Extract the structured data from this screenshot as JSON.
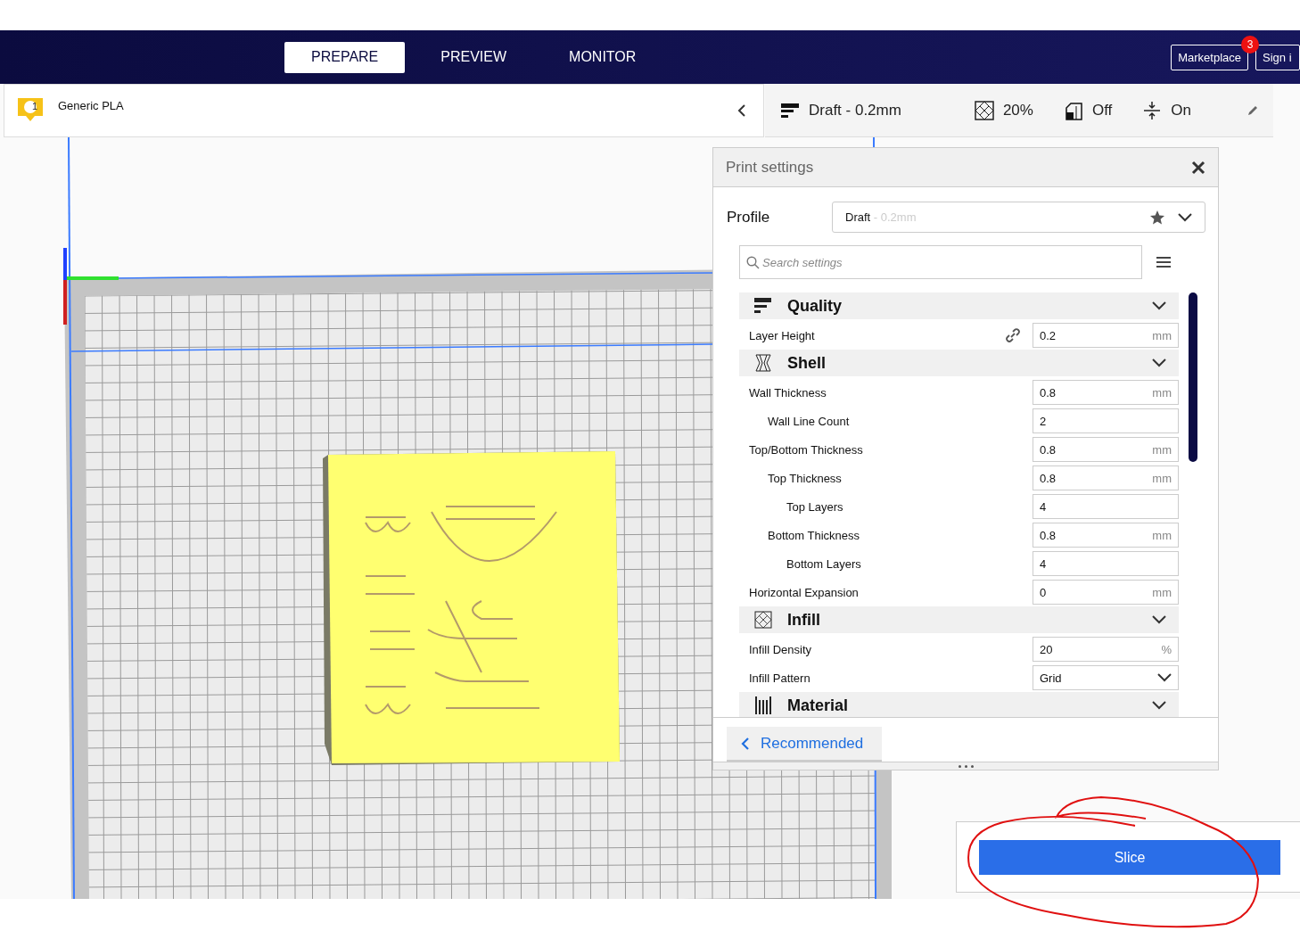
{
  "header": {
    "tabs": [
      {
        "label": "PREPARE",
        "selected": true
      },
      {
        "label": "PREVIEW",
        "selected": false
      },
      {
        "label": "MONITOR",
        "selected": false
      }
    ],
    "marketplace": {
      "label": "Marketplace",
      "badge": "3"
    },
    "sign_in": "Sign i"
  },
  "material_bar": {
    "extruder": "1",
    "material": "Generic PLA"
  },
  "settings_summary": {
    "profile": "Draft - 0.2mm",
    "infill": "20%",
    "support": "Off",
    "adhesion": "On"
  },
  "print_settings": {
    "title": "Print settings",
    "profile_label": "Profile",
    "profile": {
      "name": "Draft",
      "detail": " - 0.2mm"
    },
    "search": {
      "placeholder": "Search settings"
    },
    "categories": [
      {
        "title": "Quality",
        "kind": "quality",
        "expanded": true,
        "settings": [
          {
            "label": "Layer Height",
            "value": "0.2",
            "unit": "mm",
            "kind": "number",
            "linked": true
          }
        ]
      },
      {
        "title": "Shell",
        "kind": "shell",
        "expanded": true,
        "settings": [
          {
            "label": "Wall Thickness",
            "value": "0.8",
            "unit": "mm",
            "kind": "number",
            "children": [
              {
                "label": "Wall Line Count",
                "value": "2",
                "kind": "number"
              }
            ]
          },
          {
            "label": "Top/Bottom Thickness",
            "value": "0.8",
            "unit": "mm",
            "kind": "number",
            "children": [
              {
                "label": "Top Thickness",
                "value": "0.8",
                "unit": "mm",
                "kind": "number",
                "children": [
                  {
                    "label": "Top Layers",
                    "value": "4",
                    "kind": "number"
                  }
                ]
              },
              {
                "label": "Bottom Thickness",
                "value": "0.8",
                "unit": "mm",
                "kind": "number",
                "children": [
                  {
                    "label": "Bottom Layers",
                    "value": "4",
                    "kind": "number"
                  }
                ]
              }
            ]
          },
          {
            "label": "Horizontal Expansion",
            "value": "0",
            "unit": "mm",
            "kind": "number"
          }
        ]
      },
      {
        "title": "Infill",
        "kind": "infill",
        "expanded": true,
        "settings": [
          {
            "label": "Infill Density",
            "value": "20",
            "unit": "%",
            "kind": "number"
          },
          {
            "label": "Infill Pattern",
            "value": "Grid",
            "kind": "dropdown"
          }
        ]
      },
      {
        "title": "Material",
        "kind": "material",
        "expanded": true
      }
    ],
    "recommended": "Recommended"
  },
  "slice_button": "Slice"
}
